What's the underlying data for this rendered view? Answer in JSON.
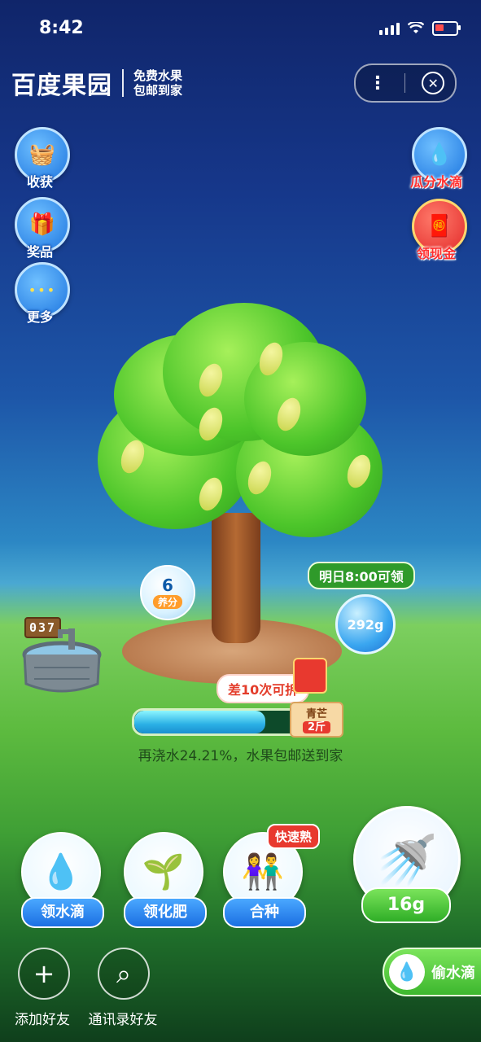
{
  "status": {
    "time": "8:42"
  },
  "brand": {
    "title": "百度果园",
    "subtitle_line1": "免费水果",
    "subtitle_line2": "包邮到家"
  },
  "capsule": {
    "more_glyph": "⋮",
    "close_glyph": "✕"
  },
  "left_menu": [
    {
      "label": "收获",
      "icon": "harvest-basket-icon",
      "glyph": "🧺"
    },
    {
      "label": "奖品",
      "icon": "prize-card-icon",
      "glyph": "🎁"
    },
    {
      "label": "更多",
      "icon": "more-dots-icon",
      "glyph": "•••"
    }
  ],
  "right_menu": [
    {
      "label": "瓜分水滴",
      "icon": "water-split-icon",
      "glyph": "💧"
    },
    {
      "label": "领现金",
      "icon": "cash-redpacket-icon",
      "glyph": "🧧"
    }
  ],
  "score": {
    "value": "6",
    "label": "养分"
  },
  "well": {
    "counter": "037"
  },
  "bottle": {
    "tip": "明日8:00可领",
    "amount": "292g"
  },
  "progress": {
    "pill": "差10次可拆",
    "percent": 0.7579,
    "fruit_name": "青芒",
    "fruit_weight": "2斤",
    "hint": "再浇水24.21%，水果包邮送到家"
  },
  "actions": [
    {
      "label": "领水滴",
      "icon": "water-drop-hand-icon",
      "glyph": "💧"
    },
    {
      "label": "领化肥",
      "icon": "fertilizer-sack-icon",
      "glyph": "🌱"
    },
    {
      "label": "合种",
      "icon": "co-plant-people-icon",
      "glyph": "👫",
      "tag": "快速熟"
    }
  ],
  "watering": {
    "amount": "16g",
    "icon": "watering-can-icon",
    "glyph": "🚿"
  },
  "friends": [
    {
      "label": "添加好友",
      "icon": "plus-icon",
      "glyph": "+"
    },
    {
      "label": "通讯录好友",
      "icon": "search-icon",
      "glyph": "⌕"
    }
  ],
  "steal": {
    "label": "偷水滴",
    "glyph": "💧"
  }
}
